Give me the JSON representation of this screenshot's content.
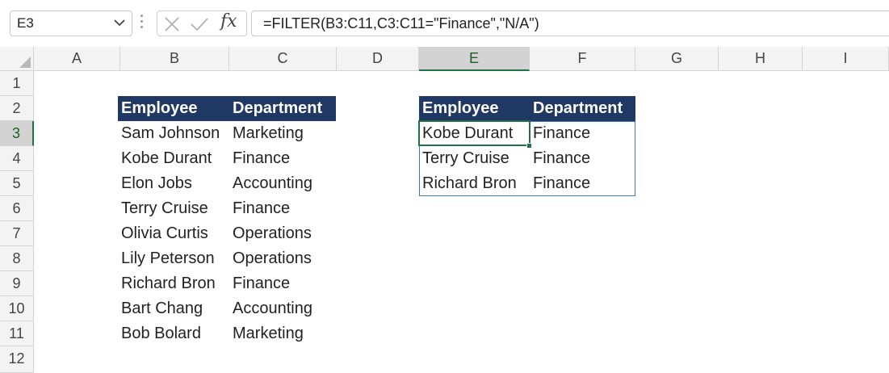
{
  "name_box": {
    "value": "E3"
  },
  "formula_bar": {
    "formula": "=FILTER(B3:C11,C3:C11=\"Finance\",\"N/A\")",
    "fx_label": "fx",
    "cancel_icon": "x-icon",
    "enter_icon": "check-icon"
  },
  "columns": [
    {
      "label": "A"
    },
    {
      "label": "B"
    },
    {
      "label": "C"
    },
    {
      "label": "D"
    },
    {
      "label": "E"
    },
    {
      "label": "F"
    },
    {
      "label": "G"
    },
    {
      "label": "H"
    },
    {
      "label": "I"
    }
  ],
  "rows": [
    {
      "label": "1"
    },
    {
      "label": "2"
    },
    {
      "label": "3"
    },
    {
      "label": "4"
    },
    {
      "label": "5"
    },
    {
      "label": "6"
    },
    {
      "label": "7"
    },
    {
      "label": "8"
    },
    {
      "label": "9"
    },
    {
      "label": "10"
    },
    {
      "label": "11"
    },
    {
      "label": "12"
    }
  ],
  "source_table": {
    "headers": [
      "Employee",
      "Department"
    ],
    "rows": [
      [
        "Sam Johnson",
        "Marketing"
      ],
      [
        "Kobe Durant",
        "Finance"
      ],
      [
        "Elon Jobs",
        "Accounting"
      ],
      [
        "Terry Cruise",
        "Finance"
      ],
      [
        "Olivia Curtis",
        "Operations"
      ],
      [
        "Lily Peterson",
        "Operations"
      ],
      [
        "Richard Bron",
        "Finance"
      ],
      [
        "Bart Chang",
        "Accounting"
      ],
      [
        "Bob Bolard",
        "Marketing"
      ]
    ]
  },
  "result_table": {
    "headers": [
      "Employee",
      "Department"
    ],
    "rows": [
      [
        "Kobe Durant",
        "Finance"
      ],
      [
        "Terry Cruise",
        "Finance"
      ],
      [
        "Richard Bron",
        "Finance"
      ]
    ]
  },
  "colors": {
    "header_bg": "#203864",
    "selection": "#217346",
    "spill_border": "#4472c4"
  }
}
